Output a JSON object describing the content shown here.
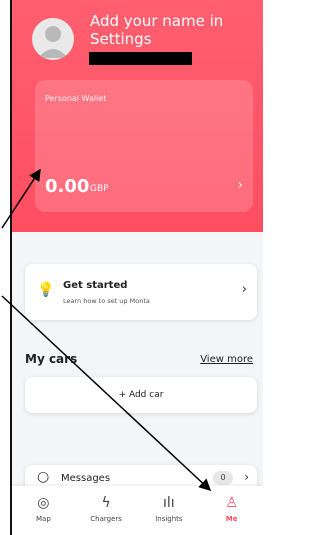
{
  "profile": {
    "name_prompt": "Add your name in Settings"
  },
  "wallet": {
    "title": "Personal Wallet",
    "amount": "0.00",
    "currency": "GBP"
  },
  "get_started": {
    "title": "Get started",
    "subtitle": "Learn how to set up Monta"
  },
  "cars": {
    "heading": "My cars",
    "view_more": "View more",
    "add_car": "+ Add car"
  },
  "messages": {
    "label": "Messages",
    "count": "0"
  },
  "nav": [
    {
      "label": "Map",
      "icon": "map-pin-icon"
    },
    {
      "label": "Chargers",
      "icon": "lightning-icon"
    },
    {
      "label": "Insights",
      "icon": "bar-chart-icon"
    },
    {
      "label": "Me",
      "icon": "person-icon"
    }
  ],
  "colors": {
    "accent": "#ff4a61",
    "header": "#ff5f6f"
  }
}
